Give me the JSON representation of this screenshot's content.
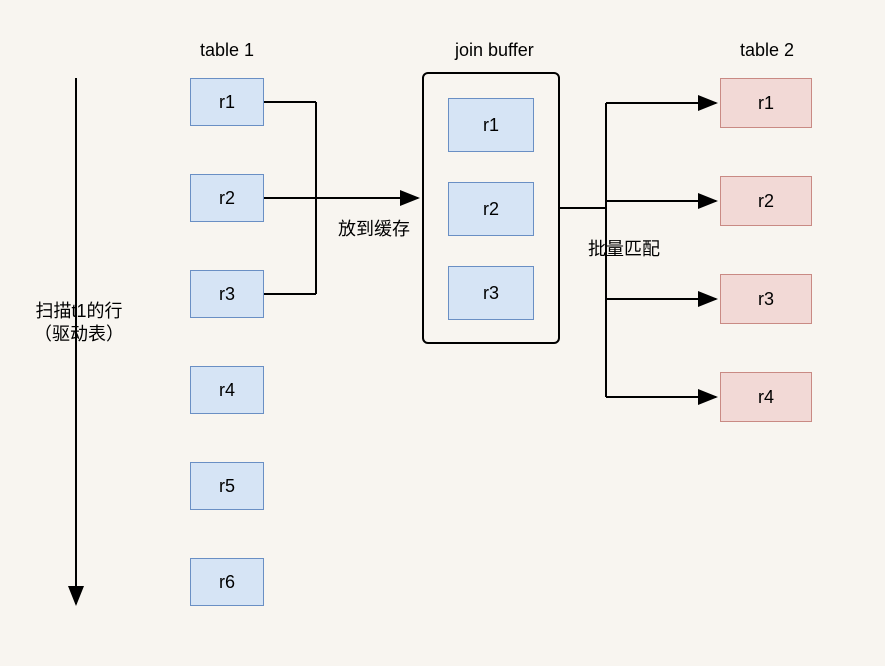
{
  "labels": {
    "table1": "table 1",
    "joinBuffer": "join buffer",
    "table2": "table 2",
    "scanDesc": "扫描t1的行\n（驱动表）",
    "putCache": "放到缓存",
    "batchMatch": "批量匹配"
  },
  "table1": {
    "rows": [
      "r1",
      "r2",
      "r3",
      "r4",
      "r5",
      "r6"
    ]
  },
  "joinBuffer": {
    "rows": [
      "r1",
      "r2",
      "r3"
    ]
  },
  "table2": {
    "rows": [
      "r1",
      "r2",
      "r3",
      "r4"
    ]
  },
  "colors": {
    "blueFill": "#d6e4f5",
    "blueBorder": "#6a8fc4",
    "redFill": "#f2d9d6",
    "redBorder": "#c98a84"
  }
}
